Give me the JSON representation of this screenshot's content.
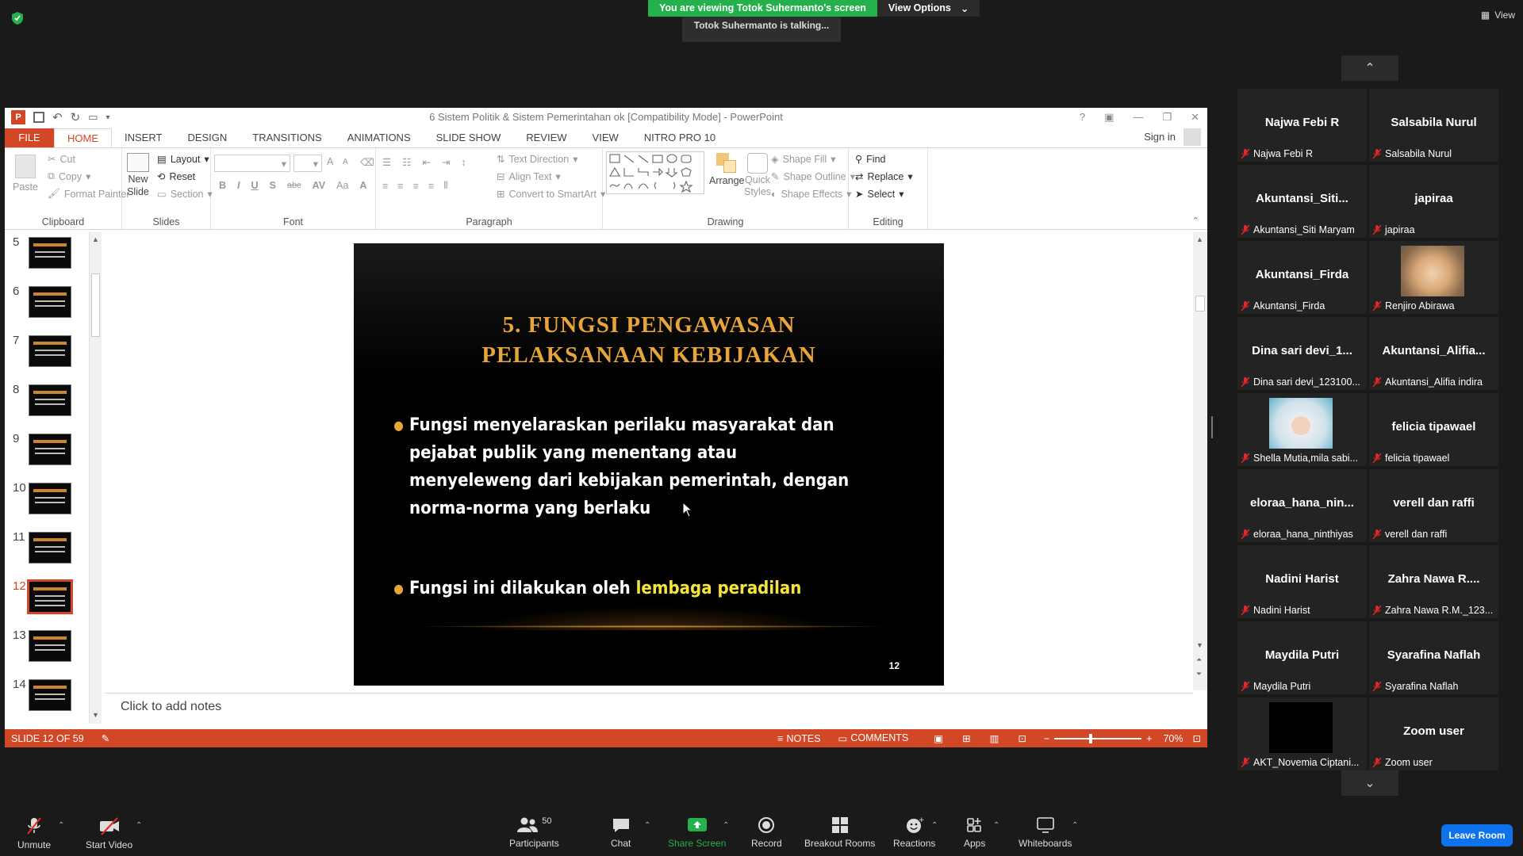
{
  "share_banner": {
    "text": "You are viewing Totok Suhermanto's screen",
    "view_options": "View Options",
    "talking": "Totok Suhermanto is talking..."
  },
  "top_right": {
    "view": "View"
  },
  "ppt": {
    "window_title": "6 Sistem Politik & Sistem Pemerintahan ok [Compatibility Mode] - PowerPoint",
    "help": "?",
    "tabs": [
      "FILE",
      "HOME",
      "INSERT",
      "DESIGN",
      "TRANSITIONS",
      "ANIMATIONS",
      "SLIDE SHOW",
      "REVIEW",
      "VIEW",
      "NITRO PRO 10"
    ],
    "sign_in": "Sign in",
    "clipboard": {
      "paste": "Paste",
      "cut": "Cut",
      "copy": "Copy",
      "format_painter": "Format Painter",
      "label": "Clipboard"
    },
    "slides": {
      "new_slide_1": "New",
      "new_slide_2": "Slide",
      "layout": "Layout",
      "reset": "Reset",
      "section": "Section",
      "label": "Slides"
    },
    "font": {
      "label": "Font",
      "bold": "B",
      "italic": "I",
      "underline": "U",
      "shadow": "S",
      "strike": "abc",
      "spacing": "AV",
      "case": "Aa",
      "grow": "A",
      "shrink": "A",
      "color": "A"
    },
    "paragraph": {
      "label": "Paragraph",
      "text_direction": "Text Direction",
      "align_text": "Align Text",
      "convert_smartart": "Convert to SmartArt"
    },
    "drawing": {
      "label": "Drawing",
      "arrange": "Arrange",
      "quick_styles_1": "Quick",
      "quick_styles_2": "Styles",
      "shape_fill": "Shape Fill",
      "shape_outline": "Shape Outline",
      "shape_effects": "Shape Effects"
    },
    "editing": {
      "label": "Editing",
      "find": "Find",
      "replace": "Replace",
      "select": "Select"
    },
    "thumbnails": [
      {
        "num": "5"
      },
      {
        "num": "6"
      },
      {
        "num": "7"
      },
      {
        "num": "8"
      },
      {
        "num": "9"
      },
      {
        "num": "10"
      },
      {
        "num": "11"
      },
      {
        "num": "12"
      },
      {
        "num": "13"
      },
      {
        "num": "14"
      }
    ],
    "selected_slide": "12",
    "slide": {
      "title_line1": "5. FUNGSI PENGAWASAN",
      "title_line2": "PELAKSANAAN KEBIJAKAN",
      "bullet1": "Fungsi menyelaraskan perilaku masyarakat dan pejabat publik yang menentang atau menyeleweng dari kebijakan pemerintah, dengan norma-norma yang berlaku",
      "bullet2_prefix": "Fungsi ini dilakukan oleh ",
      "bullet2_highlight": "lembaga peradilan",
      "number": "12"
    },
    "notes_placeholder": "Click to add notes",
    "status": {
      "slide_of": "SLIDE 12 OF 59",
      "notes": "NOTES",
      "comments": "COMMENTS",
      "zoom": "70%"
    }
  },
  "participants_gallery": [
    {
      "display": "Najwa Febi R",
      "name": "Najwa Febi R"
    },
    {
      "display": "Salsabila Nurul",
      "name": "Salsabila Nurul"
    },
    {
      "display": "Akuntansi_Siti...",
      "name": "Akuntansi_Siti Maryam"
    },
    {
      "display": "japiraa",
      "name": "japiraa"
    },
    {
      "display": "Akuntansi_Firda",
      "name": "Akuntansi_Firda"
    },
    {
      "display": "",
      "name": "Renjiro Abirawa",
      "photo": "cat"
    },
    {
      "display": "Dina sari devi_1...",
      "name": "Dina sari devi_123100..."
    },
    {
      "display": "Akuntansi_Alifia...",
      "name": "Akuntansi_Alifia indira"
    },
    {
      "display": "",
      "name": "Shella Mutia,mila sabi...",
      "photo": "hijab"
    },
    {
      "display": "felicia tipawael",
      "name": "felicia tipawael"
    },
    {
      "display": "eloraa_hana_nin...",
      "name": "eloraa_hana_ninthiyas"
    },
    {
      "display": "verell dan raffi",
      "name": "verell dan raffi"
    },
    {
      "display": "Nadini Harist",
      "name": "Nadini Harist"
    },
    {
      "display": "Zahra Nawa R....",
      "name": "Zahra Nawa R.M._123..."
    },
    {
      "display": "Maydila Putri",
      "name": "Maydila Putri"
    },
    {
      "display": "Syarafina Naflah",
      "name": "Syarafina Naflah"
    },
    {
      "display": "",
      "name": "AKT_Novemia Ciptani...",
      "photo": "black"
    },
    {
      "display": "Zoom user",
      "name": "Zoom user"
    }
  ],
  "toolbar": {
    "unmute": "Unmute",
    "start_video": "Start Video",
    "participants": "Participants",
    "participants_count": "50",
    "chat": "Chat",
    "share_screen": "Share Screen",
    "record": "Record",
    "breakout_rooms": "Breakout Rooms",
    "reactions": "Reactions",
    "apps": "Apps",
    "whiteboards": "Whiteboards",
    "leave_room": "Leave Room"
  },
  "colors": {
    "ppt_accent": "#d24726",
    "share_green": "#24b04b",
    "slide_title": "#e8a53a",
    "highlight": "#f6e43c",
    "leave_blue": "#0e72ed"
  }
}
